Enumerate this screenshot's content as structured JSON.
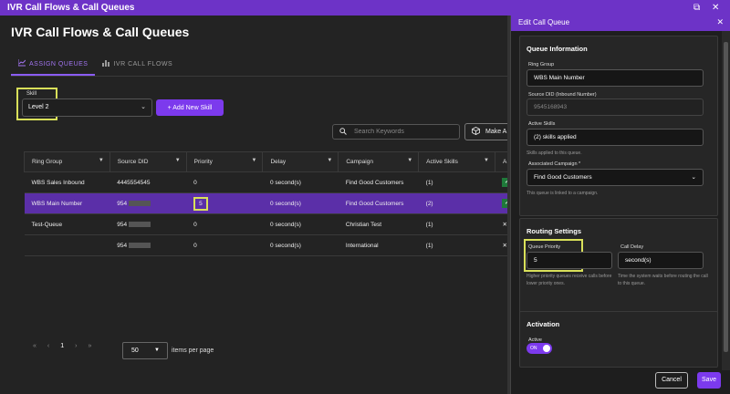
{
  "window": {
    "title": "IVR Call Flows & Call Queues",
    "restore_glyph": "⧉",
    "close_glyph": "✕"
  },
  "page": {
    "title": "IVR Call Flows & Call Queues"
  },
  "tabs": [
    {
      "label": "ASSIGN QUEUES",
      "icon": "chart-line-icon",
      "active": true
    },
    {
      "label": "IVR CALL FLOWS",
      "icon": "bar-chart-icon",
      "active": false
    }
  ],
  "skill": {
    "label": "Skill",
    "value": "Level 2"
  },
  "add_skill_label": "+ Add New Skill",
  "search": {
    "placeholder": "Search Keywords"
  },
  "make_button_label": "Make A",
  "table": {
    "columns": [
      "Ring Group",
      "Source DID",
      "Priority",
      "Delay",
      "Campaign",
      "Active Skills",
      "A"
    ],
    "rows": [
      {
        "ring_group": "WBS Sales Inbound",
        "source_did": "4445554545",
        "priority": "0",
        "delay": "0 second(s)",
        "campaign": "Find Good Customers",
        "active_skills": "(1)",
        "action": "✓"
      },
      {
        "ring_group": "WBS Main Number",
        "source_did": "954",
        "priority": "5",
        "delay": "0 second(s)",
        "campaign": "Find Good Customers",
        "active_skills": "(2)",
        "action": "✓"
      },
      {
        "ring_group": "Test-Queue",
        "source_did": "954",
        "priority": "0",
        "delay": "0 second(s)",
        "campaign": "Christian Test",
        "active_skills": "(1)",
        "action": "✕"
      },
      {
        "ring_group": "",
        "source_did": "954",
        "priority": "0",
        "delay": "0 second(s)",
        "campaign": "International",
        "active_skills": "(1)",
        "action": "✕"
      }
    ]
  },
  "pager": {
    "first": "«",
    "prev": "‹",
    "page": "1",
    "next": "›",
    "last": "»",
    "page_size": "50",
    "items_per_page_label": "items per page"
  },
  "panel": {
    "title": "Edit Call Queue",
    "queue_info": {
      "heading": "Queue Information",
      "ring_group_label": "Ring Group",
      "ring_group_value": "WBS Main Number",
      "source_did_label": "Source DID (Inbound Number)",
      "source_did_value": "9545168943",
      "active_skills_label": "Active Skills",
      "active_skills_value": "(2) skills applied",
      "active_skills_help": "Skills applied to this queue.",
      "campaign_label": "Associated Campaign *",
      "campaign_value": "Find Good Customers",
      "campaign_help": "This queue is linked to a campaign."
    },
    "routing": {
      "heading": "Routing Settings",
      "priority_label": "Queue Priority",
      "priority_value": "5",
      "priority_help": "Higher priority queues receive calls before lower priority ones.",
      "delay_label": "Call Delay",
      "delay_value": "second(s)",
      "delay_help": "Time the system waits before routing the call to this queue."
    },
    "activation": {
      "heading": "Activation",
      "active_label": "Active",
      "toggle_label": "ON"
    },
    "cancel_label": "Cancel",
    "save_label": "Save"
  },
  "colors": {
    "accent": "#7c3aed",
    "titlebar": "#6d33c7",
    "highlight": "#d9e05a"
  }
}
